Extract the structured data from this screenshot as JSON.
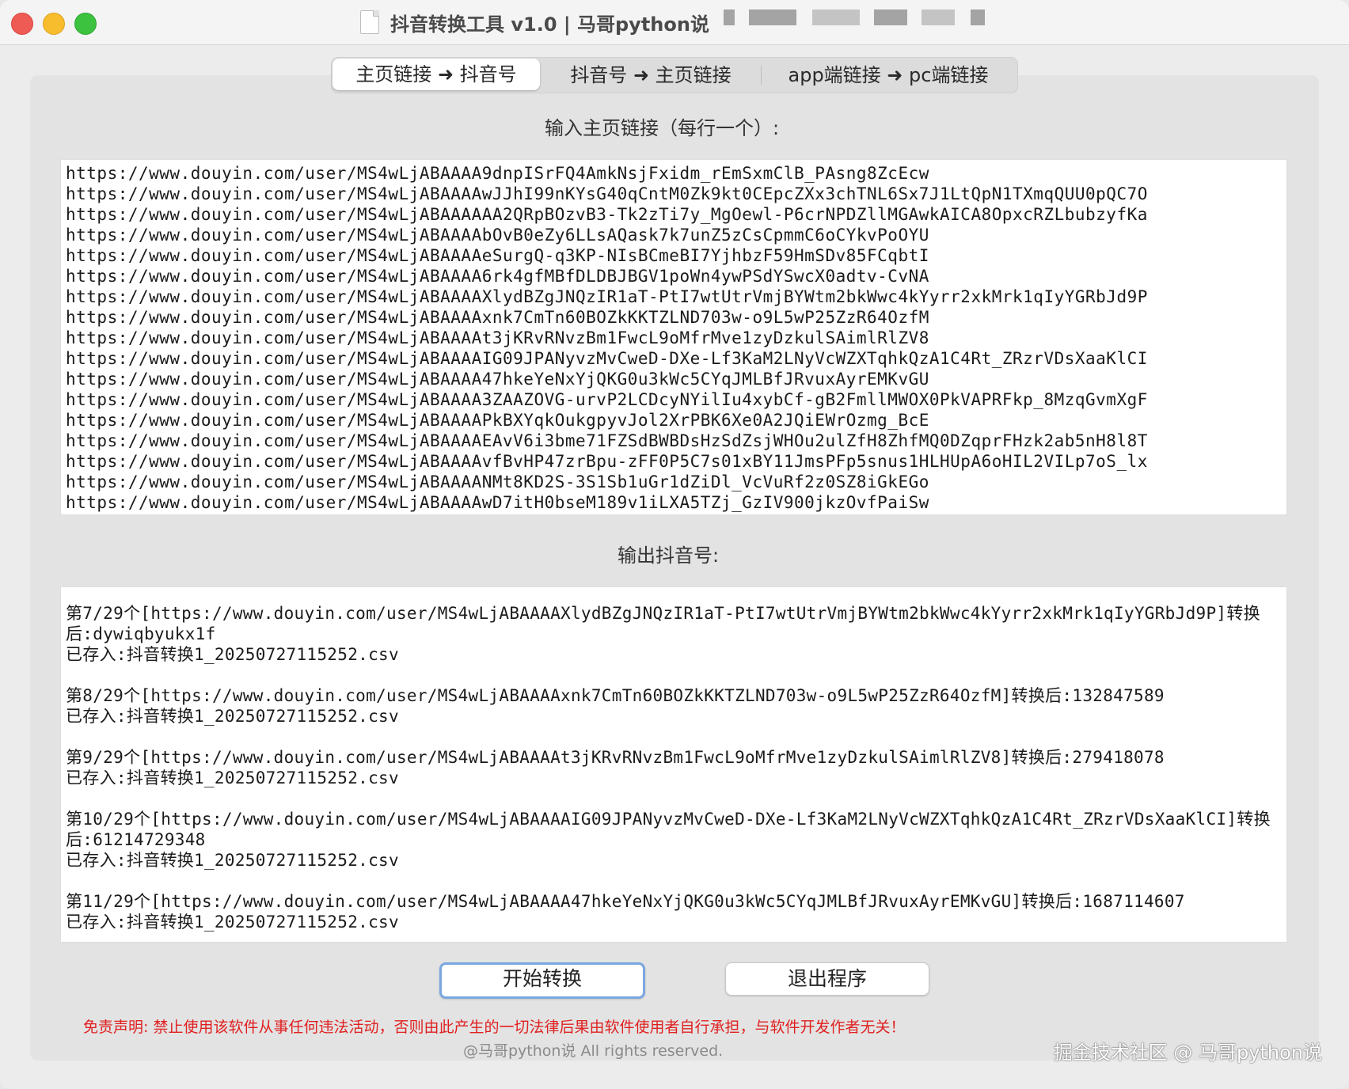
{
  "window": {
    "title": "抖音转换工具 v1.0 | 马哥python说"
  },
  "tabs": [
    {
      "label": "主页链接 ➜ 抖音号",
      "active": true
    },
    {
      "label": "抖音号 ➜ 主页链接",
      "active": false
    },
    {
      "label": "app端链接 ➜ pc端链接",
      "active": false
    }
  ],
  "input": {
    "label": "输入主页链接（每行一个）:",
    "lines": [
      "https://www.douyin.com/user/MS4wLjABAAAA9dnpISrFQ4AmkNsjFxidm_rEmSxmClB_PAsng8ZcEcw",
      "https://www.douyin.com/user/MS4wLjABAAAAwJJhI99nKYsG40qCntM0Zk9kt0CEpcZXx3chTNL6Sx7J1LtQpN1TXmqQUU0pQC7O",
      "https://www.douyin.com/user/MS4wLjABAAAAAA2QRpBOzvB3-Tk2zTi7y_MgOewl-P6crNPDZllMGAwkAICA8OpxcRZLbubzyfKa",
      "https://www.douyin.com/user/MS4wLjABAAAAbOvB0eZy6LLsAQask7k7unZ5zCsCpmmC6oCYkvPoOYU",
      "https://www.douyin.com/user/MS4wLjABAAAAeSurgQ-q3KP-NIsBCmeBI7YjhbzF59HmSDv85FCqbtI",
      "https://www.douyin.com/user/MS4wLjABAAAA6rk4gfMBfDLDBJBGV1poWn4ywPSdYSwcX0adtv-CvNA",
      "https://www.douyin.com/user/MS4wLjABAAAAXlydBZgJNQzIR1aT-PtI7wtUtrVmjBYWtm2bkWwc4kYyrr2xkMrk1qIyYGRbJd9P",
      "https://www.douyin.com/user/MS4wLjABAAAAxnk7CmTn60BOZkKKTZLND703w-o9L5wP25ZzR64OzfM",
      "https://www.douyin.com/user/MS4wLjABAAAAt3jKRvRNvzBm1FwcL9oMfrMve1zyDzkulSAimlRlZV8",
      "https://www.douyin.com/user/MS4wLjABAAAAIG09JPANyvzMvCweD-DXe-Lf3KaM2LNyVcWZXTqhkQzA1C4Rt_ZRzrVDsXaaKlCI",
      "https://www.douyin.com/user/MS4wLjABAAAA47hkeYeNxYjQKG0u3kWc5CYqJMLBfJRvuxAyrEMKvGU",
      "https://www.douyin.com/user/MS4wLjABAAAA3ZAAZOVG-urvP2LCDcyNYilIu4xybCf-gB2FmllMWOX0PkVAPRFkp_8MzqGvmXgF",
      "https://www.douyin.com/user/MS4wLjABAAAAPkBXYqkOukgpyvJol2XrPBK6Xe0A2JQiEWrOzmg_BcE",
      "https://www.douyin.com/user/MS4wLjABAAAAEAvV6i3bme71FZSdBWBDsHzSdZsjWHOu2ulZfH8ZhfMQ0DZqprFHzk2ab5nH8l8T",
      "https://www.douyin.com/user/MS4wLjABAAAAvfBvHP47zrBpu-zFF0P5C7s01xBY11JmsPFp5snus1HLHUpA6oHIL2VILp7oS_lx",
      "https://www.douyin.com/user/MS4wLjABAAAANMt8KD2S-3S1Sb1uGr1dZiDl_VcVuRf2z0SZ8iGkEGo",
      "https://www.douyin.com/user/MS4wLjABAAAAwD7itH0bseM189v1iLXA5TZj_GzIV900jkzOvfPaiSw"
    ]
  },
  "output": {
    "label": "输出抖音号:",
    "blocks": [
      {
        "result": "第7/29个[https://www.douyin.com/user/MS4wLjABAAAAXlydBZgJNQzIR1aT-PtI7wtUtrVmjBYWtm2bkWwc4kYyrr2xkMrk1qIyYGRbJd9P]转换后:dywiqbyukx1f",
        "saved": "已存入:抖音转换1_20250727115252.csv"
      },
      {
        "result": "第8/29个[https://www.douyin.com/user/MS4wLjABAAAAxnk7CmTn60BOZkKKTZLND703w-o9L5wP25ZzR64OzfM]转换后:132847589",
        "saved": "已存入:抖音转换1_20250727115252.csv"
      },
      {
        "result": "第9/29个[https://www.douyin.com/user/MS4wLjABAAAAt3jKRvRNvzBm1FwcL9oMfrMve1zyDzkulSAimlRlZV8]转换后:279418078",
        "saved": "已存入:抖音转换1_20250727115252.csv"
      },
      {
        "result": "第10/29个[https://www.douyin.com/user/MS4wLjABAAAAIG09JPANyvzMvCweD-DXe-Lf3KaM2LNyVcWZXTqhkQzA1C4Rt_ZRzrVDsXaaKlCI]转换后:61214729348",
        "saved": "已存入:抖音转换1_20250727115252.csv"
      },
      {
        "result": "第11/29个[https://www.douyin.com/user/MS4wLjABAAAA47hkeYeNxYjQKG0u3kWc5CYqJMLBfJRvuxAyrEMKvGU]转换后:1687114607",
        "saved": "已存入:抖音转换1_20250727115252.csv"
      }
    ]
  },
  "buttons": {
    "start": "开始转换",
    "exit": "退出程序"
  },
  "footer": {
    "disclaimer": "免责声明: 禁止使用该软件从事任何违法活动，否则由此产生的一切法律后果由软件使用者自行承担，与软件开发作者无关！",
    "copyright": "@马哥python说 All rights reserved.",
    "watermark": "掘金技术社区 @ 马哥python说"
  },
  "colors": {
    "disclaimer": "#e02020",
    "primary_button_border": "#7aa7e0",
    "close": "#ee5b55",
    "minimize": "#f7bd2d",
    "maximize": "#3cc23f"
  }
}
